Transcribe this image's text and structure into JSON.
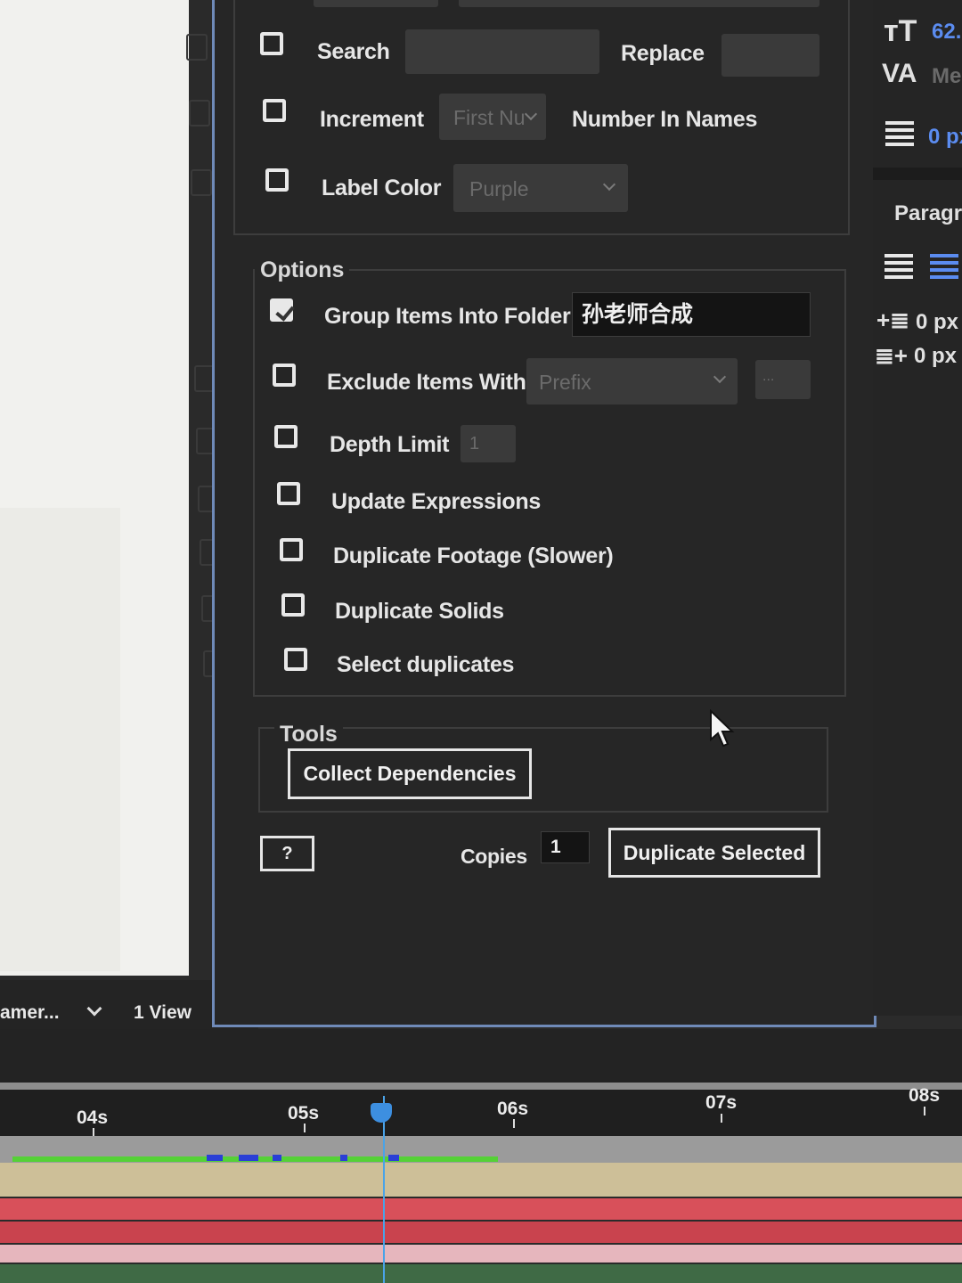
{
  "rename": {
    "search_label": "Search",
    "replace_label": "Replace",
    "increment_label": "Increment",
    "increment_mode": "First Nu",
    "number_in_names_label": "Number In Names",
    "label_color_label": "Label Color",
    "label_color_value": "Purple"
  },
  "options": {
    "title": "Options",
    "group_folder_label": "Group Items Into Folder",
    "group_folder_value": "孙老师合成",
    "exclude_label": "Exclude Items With",
    "exclude_mode": "Prefix",
    "exclude_more": "...",
    "depth_limit_label": "Depth Limit",
    "depth_limit_value": "1",
    "update_expressions_label": "Update Expressions",
    "duplicate_footage_label": "Duplicate Footage (Slower)",
    "duplicate_solids_label": "Duplicate Solids",
    "select_duplicates_label": "Select duplicates"
  },
  "tools": {
    "title": "Tools",
    "collect_label": "Collect Dependencies"
  },
  "footer": {
    "help_label": "?",
    "copies_label": "Copies",
    "copies_value": "1",
    "duplicate_label": "Duplicate Selected"
  },
  "viewer": {
    "camera_label": "amer...",
    "view_label": "1 View"
  },
  "character_panel": {
    "font_size": "62.",
    "kerning": "Me",
    "stroke": "0 px",
    "paragraph_title": "Paragra",
    "indent_left": "0 px",
    "indent_right": "0 px"
  },
  "timeline": {
    "ticks": [
      "04s",
      "05s",
      "06s",
      "07s",
      "08s"
    ]
  }
}
